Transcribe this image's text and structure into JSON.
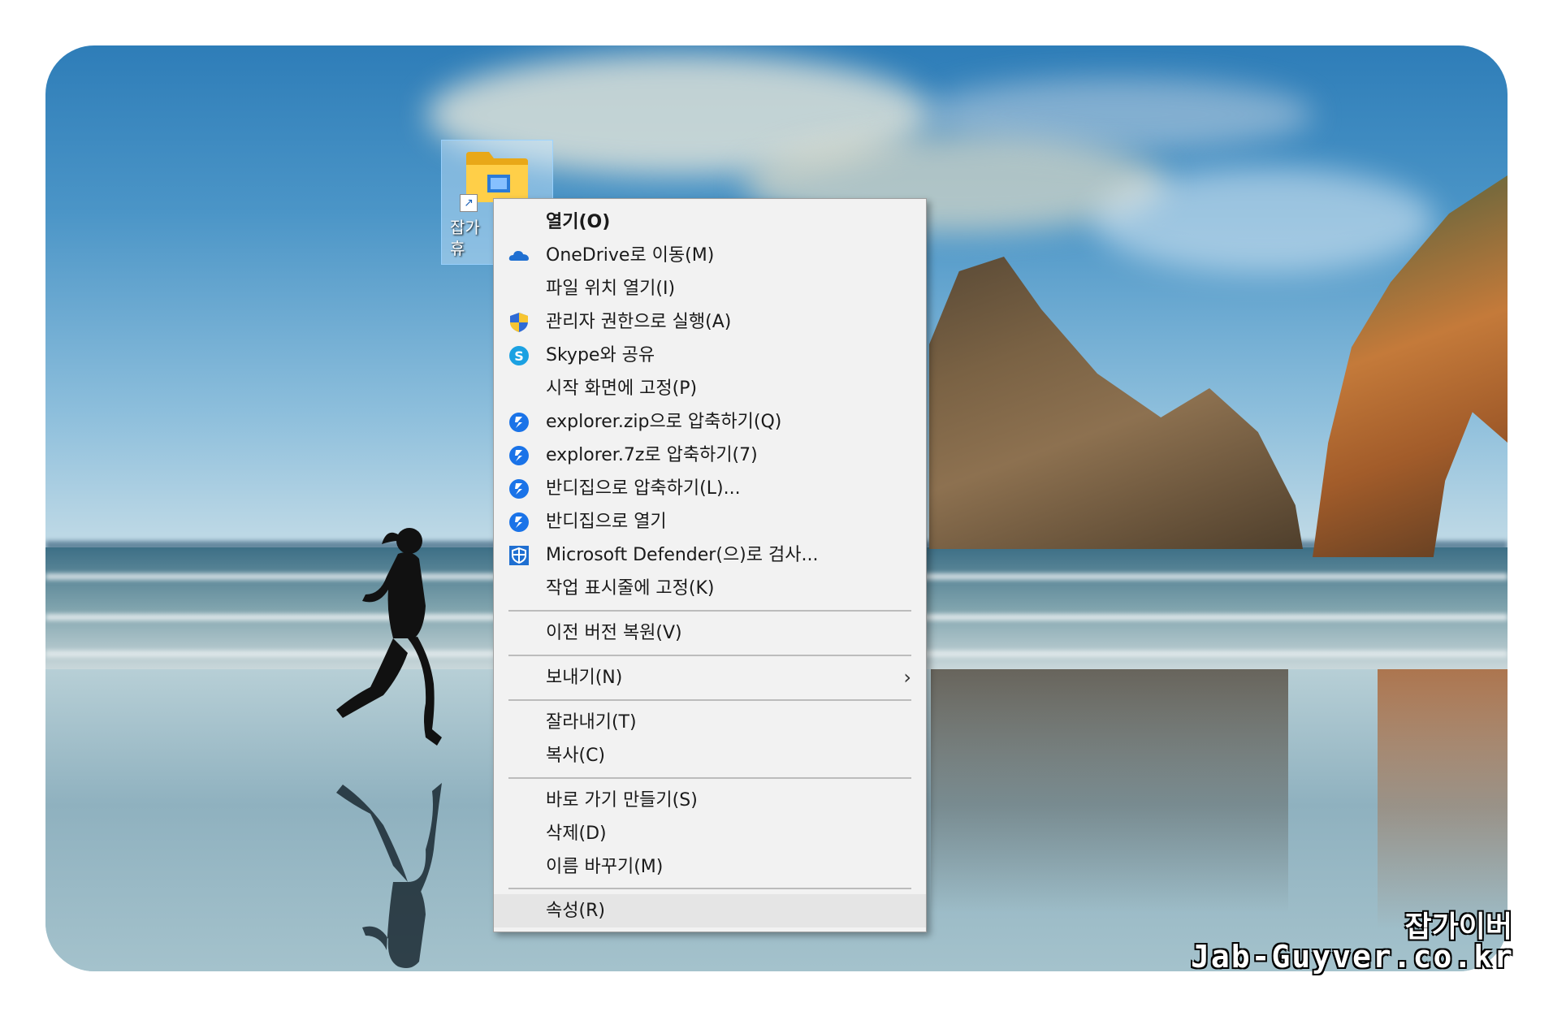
{
  "desktop_icon": {
    "label": "잡가\n휴",
    "icon": "folder-icon",
    "overlay": "shortcut-arrow-icon"
  },
  "context_menu": {
    "items": [
      {
        "label": "열기(O)",
        "icon": "",
        "bold": true
      },
      {
        "label": "OneDrive로 이동(M)",
        "icon": "onedrive-cloud-icon"
      },
      {
        "label": "파일 위치 열기(I)",
        "icon": ""
      },
      {
        "label": "관리자 권한으로 실행(A)",
        "icon": "uac-shield-icon"
      },
      {
        "label": "Skype와 공유",
        "icon": "skype-icon"
      },
      {
        "label": "시작 화면에 고정(P)",
        "icon": ""
      },
      {
        "label": "explorer.zip으로 압축하기(Q)",
        "icon": "bandizip-icon"
      },
      {
        "label": "explorer.7z로 압축하기(7)",
        "icon": "bandizip-icon"
      },
      {
        "label": "반디집으로 압축하기(L)...",
        "icon": "bandizip-icon"
      },
      {
        "label": "반디집으로 열기",
        "icon": "bandizip-icon"
      },
      {
        "label": "Microsoft Defender(으)로 검사...",
        "icon": "defender-icon"
      },
      {
        "label": "작업 표시줄에 고정(K)",
        "icon": ""
      },
      {
        "label": "이전 버전 복원(V)",
        "icon": ""
      },
      {
        "label": "보내기(N)",
        "icon": "",
        "submenu": true
      },
      {
        "label": "잘라내기(T)",
        "icon": ""
      },
      {
        "label": "복사(C)",
        "icon": ""
      },
      {
        "label": "바로 가기 만들기(S)",
        "icon": ""
      },
      {
        "label": "삭제(D)",
        "icon": ""
      },
      {
        "label": "이름 바꾸기(M)",
        "icon": ""
      },
      {
        "label": "속성(R)",
        "icon": "",
        "hovered": true
      }
    ],
    "submenu_arrow": "›"
  },
  "watermark": {
    "line1": "잡가이버",
    "line2": "Jab-Guyver.co.kr"
  },
  "colors": {
    "menu_bg": "#f2f2f2",
    "hover_bg": "#e5e5e5",
    "bandizip_blue": "#1a73e8",
    "uac_blue": "#2f6bd6",
    "uac_yellow": "#f7c531"
  }
}
